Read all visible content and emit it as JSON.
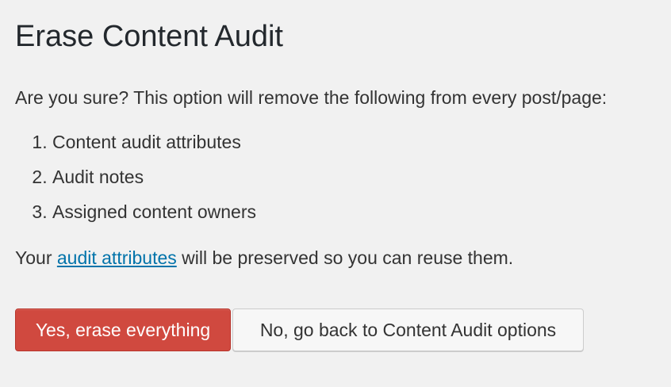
{
  "page": {
    "title": "Erase Content Audit",
    "intro": "Are you sure? This option will remove the following from every post/page:",
    "items": [
      "Content audit attributes",
      "Audit notes",
      "Assigned content owners"
    ],
    "note_prefix": "Your ",
    "note_link": "audit attributes",
    "note_suffix": " will be preserved so you can reuse them."
  },
  "actions": {
    "confirm_label": "Yes, erase everything",
    "cancel_label": "No, go back to Content Audit options"
  },
  "colors": {
    "background": "#f1f1f1",
    "danger": "#d0493f",
    "link": "#0073aa"
  }
}
